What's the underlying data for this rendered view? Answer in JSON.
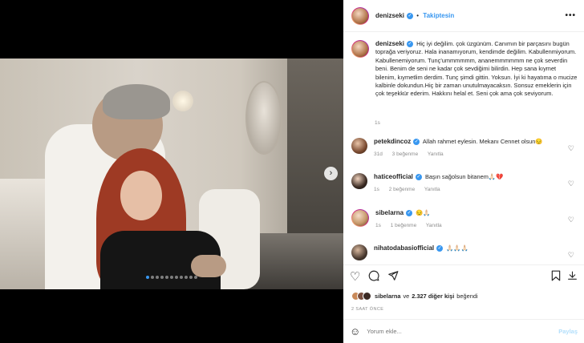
{
  "header": {
    "username": "denizseki",
    "separator": "•",
    "follow_label": "Takiptesin",
    "more_icon": "•••"
  },
  "caption": {
    "username": "denizseki",
    "text": "Hiç iyi değilim. çok üzgünüm. Canımın bir parçasını bugün toprağa veriyoruz. Hala inanamıyorum, kendimde değilim. Kabullenmiyorum. Kabullenemiyorum. Tunç'ummmmmm, ananemmmmmm ne çok severdin beni. Benim de seni ne kadar çok sevdiğimi bilirdin. Hep sana kıymet bilenim, kıymetlim derdim. Tunç şimdi gittin. Yoksun. İyi ki hayatıma o mucize kalbinle dokundun.Hiç bir zaman unutulmayacaksın. Sonsuz emeklerin için çok teşekkür ederim. Hakkını helal et. Seni çok ama çok seviyorum.",
    "time": "1s"
  },
  "comments": [
    {
      "username": "petekdincoz",
      "text": "Allah rahmet eylesin. Mekanı Cennet olsun😔",
      "time": "31d",
      "likes": "3 beğenme",
      "reply": "Yanıtla"
    },
    {
      "username": "haticeofficial",
      "text": "Başın sağolsun bitanem🙏🏻💔",
      "time": "1s",
      "likes": "2 beğenme",
      "reply": "Yanıtla"
    },
    {
      "username": "sibelarna",
      "text": "😔🙏🏻",
      "time": "1s",
      "likes": "1 beğenme",
      "reply": "Yanıtla"
    },
    {
      "username": "nihatodabasiofficial",
      "text": "🙏🏻🙏🏻🙏🏻",
      "time": "",
      "likes": "",
      "reply": ""
    }
  ],
  "actions": {
    "like_icon": "heart-icon",
    "comment_icon": "comment-icon",
    "share_icon": "share-icon",
    "save_icon": "bookmark-icon"
  },
  "likes": {
    "user": "sibelarna",
    "connector": "ve",
    "others": "2.327 diğer kişi",
    "suffix": "beğendi"
  },
  "post_time": "2 SAAT ÖNCE",
  "add_comment": {
    "placeholder": "Yorum ekle...",
    "post_label": "Paylaş"
  },
  "carousel": {
    "total": 11,
    "active": 0
  },
  "colors": {
    "accent": "#3897f0",
    "muted": "#8e8e8e",
    "post_disabled": "#b2dffc",
    "woman_hair": "#9e3a24"
  }
}
